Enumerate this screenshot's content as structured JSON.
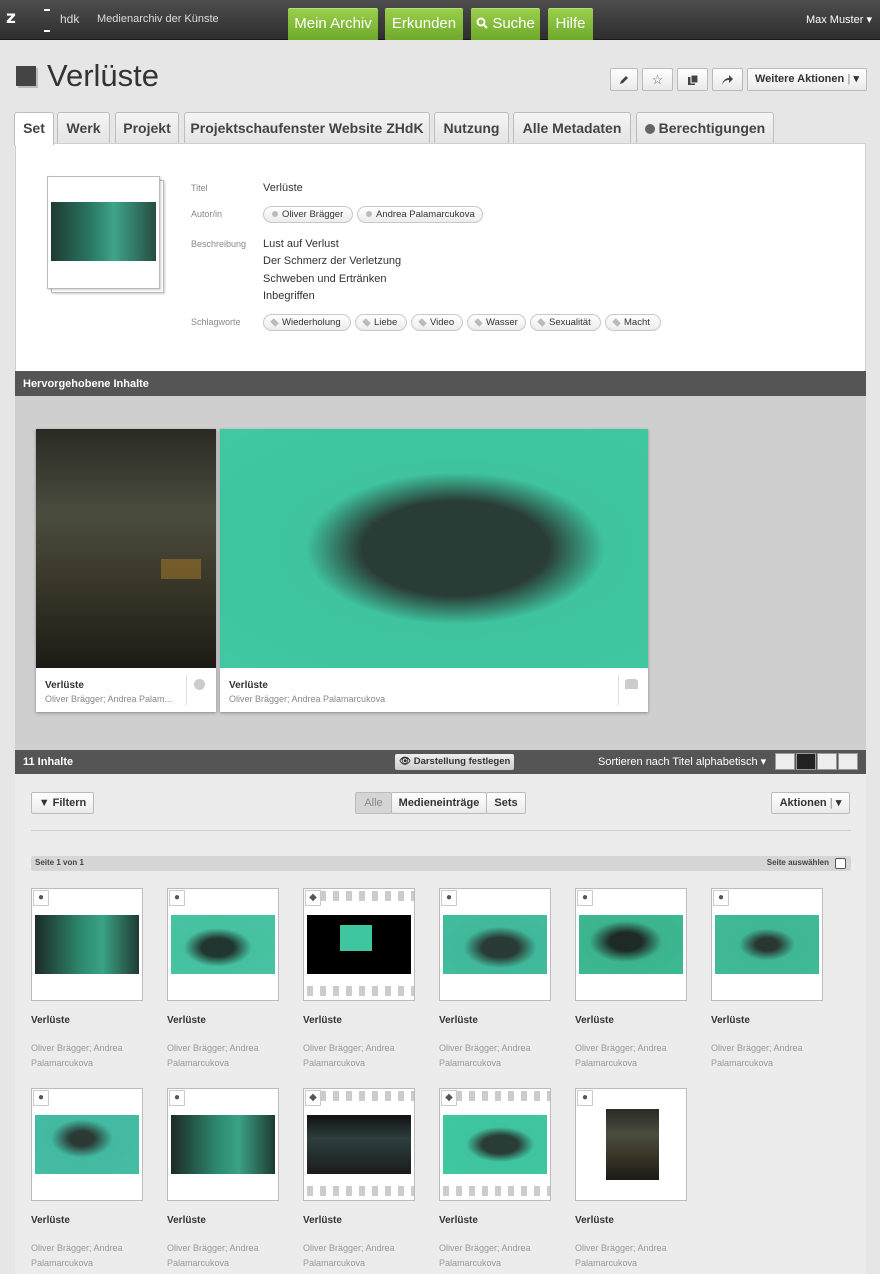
{
  "topbar": {
    "logo": "z",
    "logo_sub": "hdk",
    "site_name": "Medienarchiv der Künste",
    "nav": [
      "Mein Archiv",
      "Erkunden",
      "Suche",
      "Hilfe"
    ],
    "user": "Max Muster"
  },
  "page": {
    "title": "Verlüste",
    "more_actions": "Weitere Aktionen"
  },
  "tabs": [
    "Set",
    "Werk",
    "Projekt",
    "Projektschaufenster Website ZHdK",
    "Nutzung",
    "Alle Metadaten",
    "Berechtigungen"
  ],
  "meta": {
    "labels": {
      "title": "Titel",
      "author": "Autor/in",
      "description": "Beschreibung",
      "keywords": "Schlagworte"
    },
    "title": "Verlüste",
    "authors": [
      "Oliver Brägger",
      "Andrea Palamarcukova"
    ],
    "description": [
      "Lust auf Verlust",
      "Der Schmerz der Verletzung",
      "Schweben und Ertränken",
      "Inbegriffen"
    ],
    "keywords": [
      "Wiederholung",
      "Liebe",
      "Video",
      "Wasser",
      "Sexualität",
      "Macht"
    ]
  },
  "featured": {
    "header": "Hervorgehobene Inhalte",
    "items": [
      {
        "title": "Verlüste",
        "sub": "Oliver Brägger; Andrea Palam..."
      },
      {
        "title": "Verlüste",
        "sub": "Oliver Brägger; Andrea Palamarcukova"
      }
    ]
  },
  "contents": {
    "count_label": "11 Inhalte",
    "display_button": "Darstellung festlegen",
    "sort_label": "Sortieren nach Titel alphabetisch",
    "filter": "Filtern",
    "segments": [
      "Alle",
      "Medieneinträge",
      "Sets"
    ],
    "actions": "Aktionen",
    "page_label": "Seite 1 von 1",
    "select_page": "Seite auswählen",
    "item_title": "Verlüste",
    "item_sub": "Oliver Brägger; Andrea Palamarcukova"
  },
  "colors": {
    "green": "#7cb733",
    "teal": "#35c49a",
    "dark": "#555555"
  }
}
